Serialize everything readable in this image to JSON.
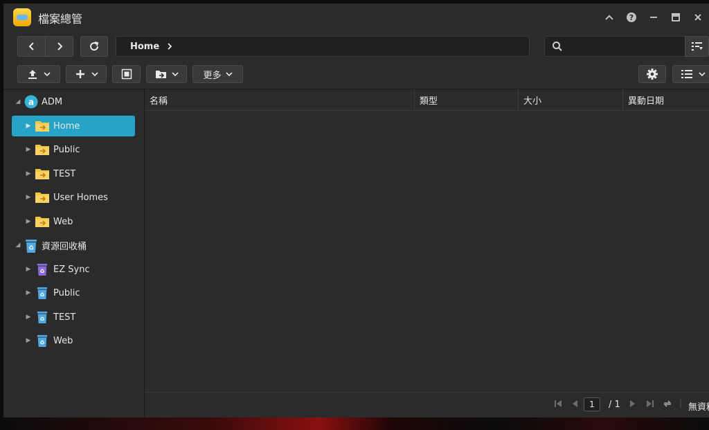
{
  "window": {
    "title": "檔案總管"
  },
  "title_controls": [
    "collapse",
    "help",
    "minimize",
    "maximize",
    "close"
  ],
  "breadcrumb": {
    "current": "Home"
  },
  "search": {
    "value": "",
    "placeholder": ""
  },
  "toolbar": {
    "more_label": "更多"
  },
  "tree": [
    {
      "label": "ADM",
      "level": 0,
      "icon": "adm-icon",
      "expanded": true
    },
    {
      "label": "Home",
      "level": 1,
      "icon": "shared-folder-icon",
      "selected": true
    },
    {
      "label": "Public",
      "level": 1,
      "icon": "shared-folder-icon"
    },
    {
      "label": "TEST",
      "level": 1,
      "icon": "shared-folder-icon"
    },
    {
      "label": "User Homes",
      "level": 1,
      "icon": "shared-folder-icon"
    },
    {
      "label": "Web",
      "level": 1,
      "icon": "shared-folder-icon"
    },
    {
      "label": "資源回收桶",
      "level": 0,
      "icon": "recycle-bin-icon",
      "expanded": true
    },
    {
      "label": "EZ Sync",
      "level": 1,
      "icon": "recycle-bin-purple-icon"
    },
    {
      "label": "Public",
      "level": 1,
      "icon": "recycle-bin-icon"
    },
    {
      "label": "TEST",
      "level": 1,
      "icon": "recycle-bin-icon"
    },
    {
      "label": "Web",
      "level": 1,
      "icon": "recycle-bin-icon"
    }
  ],
  "table": {
    "columns": [
      "名稱",
      "類型",
      "大小",
      "異動日期"
    ],
    "rows": []
  },
  "pager": {
    "page": "1",
    "total": "/ 1",
    "status": "無資料"
  },
  "colors": {
    "accent": "#27a3c8",
    "background": "#2b2b2d",
    "folder": "#f4c542"
  }
}
